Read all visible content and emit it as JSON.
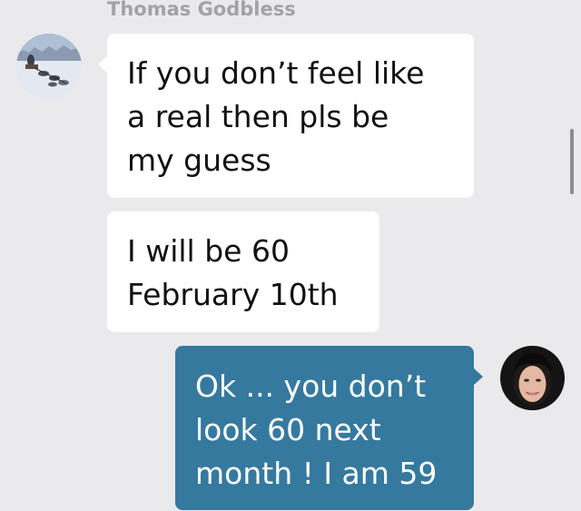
{
  "conversation": {
    "sender_name": "Thomas Godbless",
    "messages": [
      {
        "direction": "incoming",
        "text": "If you don’t feel like\na real then pls be\nmy guess"
      },
      {
        "direction": "incoming",
        "text": "I will be 60\nFebruary 10th"
      },
      {
        "direction": "outgoing",
        "text": "Ok ... you don’t\nlook 60 next\nmonth ! I am 59"
      }
    ]
  },
  "colors": {
    "background": "#eaeaec",
    "incoming_bubble": "#ffffff",
    "outgoing_bubble": "#35799e",
    "sender_name": "#a2a3a7"
  }
}
